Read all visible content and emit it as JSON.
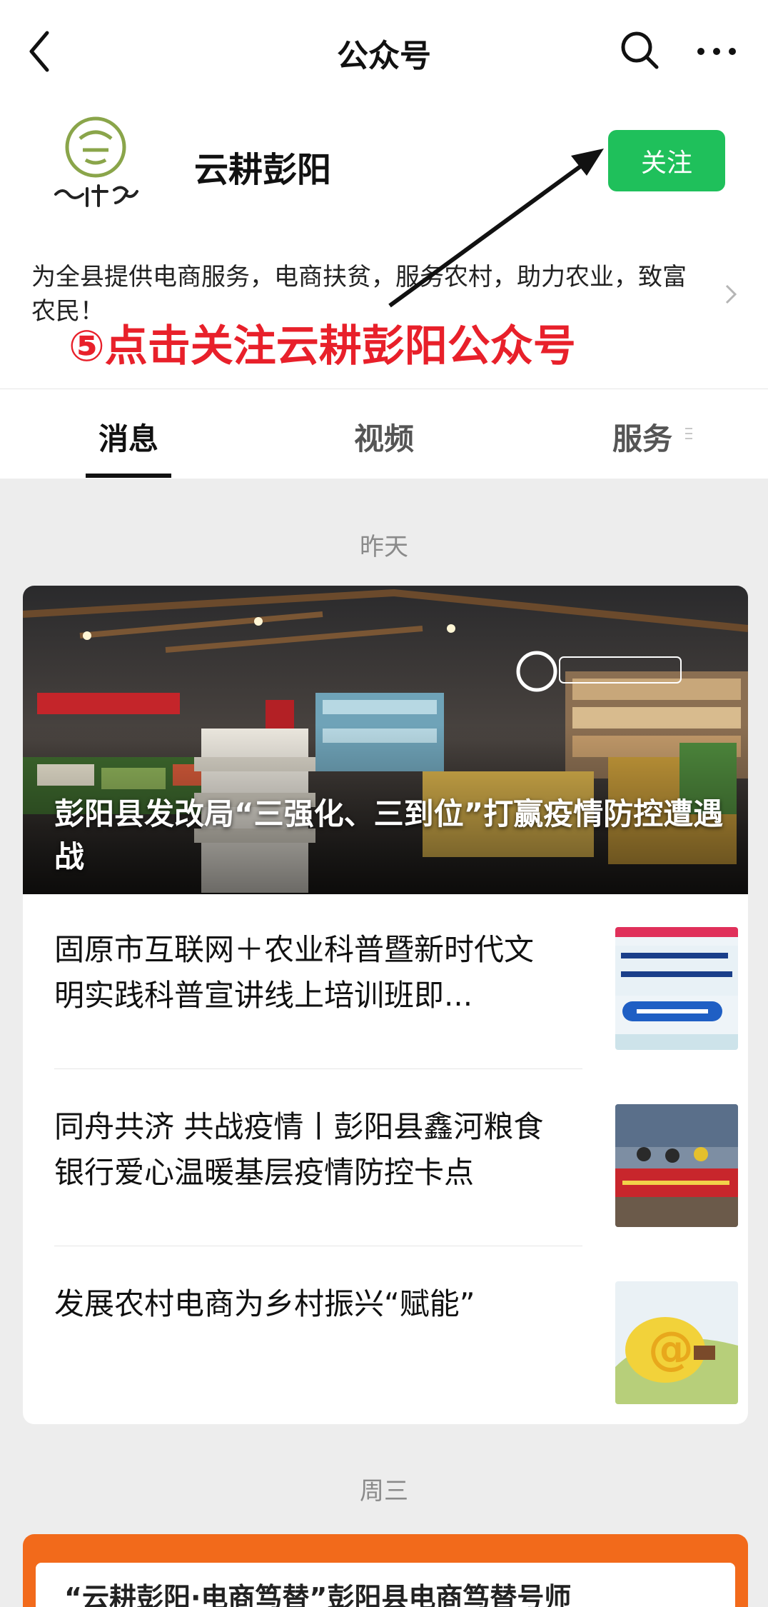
{
  "header": {
    "title": "公众号"
  },
  "account": {
    "name": "云耕彭阳",
    "follow_label": "关注",
    "description": "为全县提供电商服务，电商扶贫，服务农村，助力农业，致富农民！",
    "annotation": "⑤点击关注云耕彭阳公众号"
  },
  "tabs": {
    "items": [
      {
        "label": "消息"
      },
      {
        "label": "视频"
      },
      {
        "label": "服务"
      }
    ]
  },
  "feed": {
    "days": [
      {
        "label": "昨天"
      },
      {
        "label": "周三"
      }
    ],
    "headline": {
      "title": "彭阳县发改局“三强化、三到位”打赢疫情防控遭遇战"
    },
    "articles": [
      {
        "title": "固原市互联网＋农业科普暨新时代文明实践科普宣讲线上培训班即..."
      },
      {
        "title": "同舟共济 共战疫情丨彭阳县鑫河粮食银行爱心温暖基层疫情防控卡点"
      },
      {
        "title": "发展农村电商为乡村振兴“赋能”"
      }
    ],
    "next_card_title": "“云耕彭阳·电商笃替”彭阳县电商笃替号师"
  },
  "colors": {
    "follow_green": "#1fc05b",
    "annotation_red": "#e8202a",
    "background": "#ededed"
  }
}
